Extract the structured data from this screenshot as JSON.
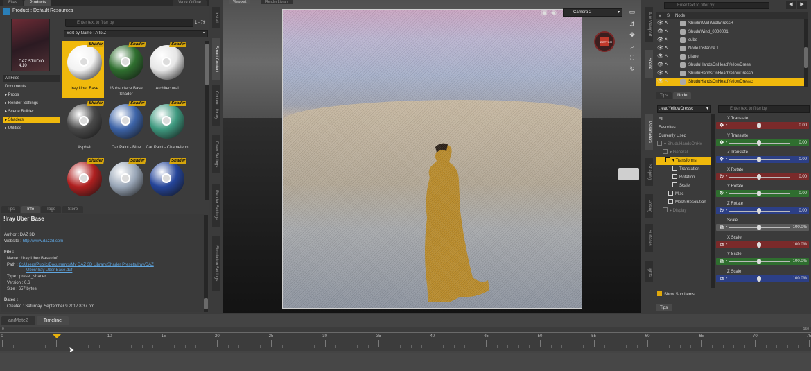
{
  "left": {
    "tabs": [
      "Files",
      "Products",
      "Work Offline"
    ],
    "product_header": "Product : Default Resources",
    "thumb_caption": "DAZ STUDIO 4.10",
    "search_placeholder": "Enter text to filter by",
    "page_count": "1 - 79",
    "sort": "Sort by Name : A to Z",
    "categories": [
      {
        "label": "All Files"
      },
      {
        "label": "Documents"
      },
      {
        "label": "▸ Props"
      },
      {
        "label": "▸ Render-Settings"
      },
      {
        "label": "▸ Scene Builder"
      },
      {
        "label": "▸ Shaders"
      },
      {
        "label": "▸ Utilities"
      }
    ],
    "shader_badge": "Shader",
    "tiles": [
      {
        "label": "Iray Uber Base",
        "color": "#f2f2f2"
      },
      {
        "label": "!Subsurface Base Shader",
        "color": "#2f6f2f"
      },
      {
        "label": "Architectural",
        "color": "#e6e6e6"
      },
      {
        "label": "Asphalt",
        "color": "#4a4a4a"
      },
      {
        "label": "Car Paint - Blue",
        "color": "#3d64a8"
      },
      {
        "label": "Car Paint - Chameleon",
        "color": "#3f9a80"
      },
      {
        "label": "",
        "color": "#b02020"
      },
      {
        "label": "",
        "color": "#9aa7b8"
      },
      {
        "label": "",
        "color": "#25459a"
      }
    ]
  },
  "info": {
    "tabs": [
      "Tips",
      "Info",
      "Tags",
      "Store"
    ],
    "title": "!Iray Uber Base",
    "author_label": "Author :",
    "author": "DAZ 3D",
    "website_label": "Website :",
    "website": "http://www.daz3d.com",
    "file_label": "File :",
    "name_label": "Name :",
    "name": "!Iray Uber Base.duf",
    "path_label": "Path :",
    "path_line1": "C:/Users/Public/Documents/My DAZ 3D Library/Shader Presets/Iray/DAZ",
    "path_line2": "Uber/!Iray Uber Base.duf",
    "type_label": "Type :",
    "type": "preset_shader",
    "version_label": "Version :",
    "version": "0.6",
    "size_label": "Size :",
    "size": "657 bytes",
    "dates_label": "Dates :",
    "created_label": "Created :",
    "created": "Saturday, September 9 2017 8:37 pm"
  },
  "vtabs_left": [
    "Install",
    "Smart Content",
    "Content Library",
    "Draw Settings",
    "Render Settings",
    "Simulation Settings"
  ],
  "viewport": {
    "tabs": [
      "Viewport",
      "Render Library"
    ],
    "camera": "Camera 2",
    "cube_label": "BOTTOM"
  },
  "vtabs_right": [
    "Aux Viewport",
    "Scene",
    "Parameters",
    "Shaping",
    "Posing",
    "Surfaces",
    "Lights"
  ],
  "scene": {
    "search_placeholder": "Enter text to filter by",
    "col_v": "V",
    "col_s": "S",
    "col_node": "Node",
    "nodes": [
      {
        "name": "ShuduWWDWalkdressB"
      },
      {
        "name": "ShuduWind_0000001"
      },
      {
        "name": "cube"
      },
      {
        "name": "Node Instance 1"
      },
      {
        "name": "plane"
      },
      {
        "name": "ShuduHandsOnHeadYellowDress"
      },
      {
        "name": "ShuduHandsOnHeadYellowDressb"
      },
      {
        "name": "ShuduHandsOnHeadYellowDressc"
      }
    ],
    "subtabs": [
      "Tips",
      "Node"
    ]
  },
  "params": {
    "node_select": "..eadYellowDressc",
    "search_placeholder": "Enter text to filter by",
    "tree": [
      {
        "label": "All"
      },
      {
        "label": "Favorites"
      },
      {
        "label": "Currently Used"
      },
      {
        "label": "▾ ShuduHandsOnHe"
      },
      {
        "label": "▾ General"
      },
      {
        "label": "▾ Transforms"
      },
      {
        "label": "Translation"
      },
      {
        "label": "Rotation"
      },
      {
        "label": "Scale"
      },
      {
        "label": "Misc"
      },
      {
        "label": "Mesh Resolution"
      },
      {
        "label": "▸ Display"
      }
    ],
    "sliders": [
      {
        "label": "X Translate",
        "value": "0.00",
        "color": "#7a2a2a",
        "icon": "move-icon",
        "pos": 0.5
      },
      {
        "label": "Y Translate",
        "value": "0.00",
        "color": "#2f6e2f",
        "icon": "move-icon",
        "pos": 0.5
      },
      {
        "label": "Z Translate",
        "value": "0.00",
        "color": "#2c3f86",
        "icon": "move-icon",
        "pos": 0.5
      },
      {
        "label": "X Rotate",
        "value": "0.00",
        "color": "#7a2a2a",
        "icon": "rotate-icon",
        "pos": 0.5
      },
      {
        "label": "Y Rotate",
        "value": "0.00",
        "color": "#2f6e2f",
        "icon": "rotate-icon",
        "pos": 0.5
      },
      {
        "label": "Z Rotate",
        "value": "0.00",
        "color": "#2c3f86",
        "icon": "rotate-icon",
        "pos": 0.5
      },
      {
        "label": "Scale",
        "value": "100.0%",
        "color": "#5a5a5a",
        "icon": "scale-icon",
        "pos": 0.5
      },
      {
        "label": "X Scale",
        "value": "100.0%",
        "color": "#7a2a2a",
        "icon": "scale-icon",
        "pos": 0.5
      },
      {
        "label": "Y Scale",
        "value": "100.0%",
        "color": "#2f6e2f",
        "icon": "scale-icon",
        "pos": 0.5
      },
      {
        "label": "Z Scale",
        "value": "100.0%",
        "color": "#2c3f86",
        "icon": "scale-icon",
        "pos": 0.5
      }
    ],
    "show_sub_items": "Show Sub Items",
    "tips_tab": "Tips"
  },
  "timeline": {
    "tabs": [
      "aniMate2",
      "Timeline"
    ],
    "ticks": [
      "0",
      "5",
      "10",
      "15",
      "20",
      "25",
      "30",
      "35",
      "40",
      "45",
      "50",
      "55",
      "60",
      "65",
      "70",
      "75"
    ],
    "top_left": "0",
    "top_right": "150",
    "current_frame": "5"
  },
  "accent": "#f0b90c"
}
